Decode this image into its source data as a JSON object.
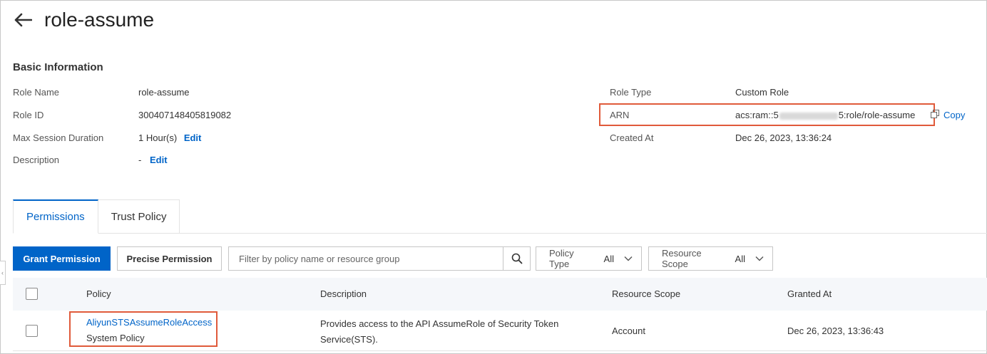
{
  "page": {
    "title": "role-assume"
  },
  "basic_info": {
    "section_title": "Basic Information",
    "left": [
      {
        "label": "Role Name",
        "value": "role-assume"
      },
      {
        "label": "Role ID",
        "value": "300407148405819082"
      },
      {
        "label": "Max Session Duration",
        "value": "1 Hour(s)",
        "action": "Edit"
      },
      {
        "label": "Description",
        "value": "-",
        "action": "Edit"
      }
    ],
    "right": {
      "role_type_label": "Role Type",
      "role_type_value": "Custom Role",
      "arn_label": "ARN",
      "arn_prefix": "acs:ram::5",
      "arn_suffix": "5:role/role-assume",
      "copy_label": "Copy",
      "created_label": "Created At",
      "created_value": "Dec 26, 2023, 13:36:24"
    }
  },
  "tabs": [
    {
      "label": "Permissions",
      "active": true
    },
    {
      "label": "Trust Policy",
      "active": false
    }
  ],
  "toolbar": {
    "grant_label": "Grant Permission",
    "precise_label": "Precise Permission",
    "search_placeholder": "Filter by policy name or resource group",
    "policy_type_label": "Policy Type",
    "policy_type_value": "All",
    "resource_scope_label": "Resource Scope",
    "resource_scope_value": "All"
  },
  "table": {
    "headers": [
      "Policy",
      "Description",
      "Resource Scope",
      "Granted At"
    ],
    "rows": [
      {
        "policy_name": "AliyunSTSAssumeRoleAccess",
        "policy_type": "System Policy",
        "description_line1": "Provides access to the API AssumeRole of Security Token",
        "description_line2": "Service(STS).",
        "resource_scope": "Account",
        "granted_at": "Dec 26, 2023, 13:36:43"
      }
    ]
  },
  "colors": {
    "accent": "#0064c8",
    "highlight_box": "#e05a3a"
  }
}
